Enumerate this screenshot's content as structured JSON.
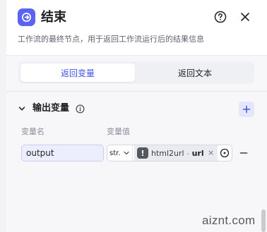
{
  "header": {
    "title": "结束",
    "description": "工作流的最终节点，用于返回工作流运行后的结果信息",
    "icon": "exit-icon",
    "accent_color": "#5a63f2"
  },
  "tabs": [
    {
      "label": "返回变量",
      "active": true
    },
    {
      "label": "返回文本",
      "active": false
    }
  ],
  "output_section": {
    "title": "输出变量",
    "columns": {
      "name": "变量名",
      "value": "变量值"
    },
    "rows": [
      {
        "name": "output",
        "type": "str.",
        "reference": {
          "node": "html2url",
          "separator": " - ",
          "variable": "url"
        }
      }
    ]
  },
  "watermark": "aiznt.com"
}
